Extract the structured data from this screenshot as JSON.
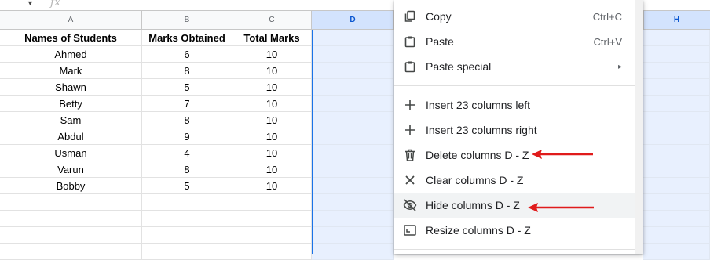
{
  "formula_bar": {
    "fx_symbol": "fx"
  },
  "column_headers": {
    "A": "A",
    "B": "B",
    "C": "C",
    "D": "D",
    "H": "H"
  },
  "table": {
    "headers": [
      "Names of Students",
      "Marks Obtained",
      "Total Marks"
    ],
    "rows": [
      [
        "Ahmed",
        "6",
        "10"
      ],
      [
        "Mark",
        "8",
        "10"
      ],
      [
        "Shawn",
        "5",
        "10"
      ],
      [
        "Betty",
        "7",
        "10"
      ],
      [
        "Sam",
        "8",
        "10"
      ],
      [
        "Abdul",
        "9",
        "10"
      ],
      [
        "Usman",
        "4",
        "10"
      ],
      [
        "Varun",
        "8",
        "10"
      ],
      [
        "Bobby",
        "5",
        "10"
      ]
    ]
  },
  "context_menu": {
    "copy": {
      "label": "Copy",
      "shortcut": "Ctrl+C",
      "icon": "copy-icon"
    },
    "paste": {
      "label": "Paste",
      "shortcut": "Ctrl+V",
      "icon": "clipboard-icon"
    },
    "paste_special": {
      "label": "Paste special",
      "icon": "clipboard-icon",
      "submenu": "▸"
    },
    "insert_left": {
      "label": "Insert 23 columns left",
      "icon": "plus-icon"
    },
    "insert_right": {
      "label": "Insert 23 columns right",
      "icon": "plus-icon"
    },
    "delete": {
      "label": "Delete columns D - Z",
      "icon": "trash-icon"
    },
    "clear": {
      "label": "Clear columns D - Z",
      "icon": "x-icon"
    },
    "hide": {
      "label": "Hide columns D - Z",
      "icon": "eye-off-icon"
    },
    "resize": {
      "label": "Resize columns D - Z",
      "icon": "resize-icon"
    }
  },
  "colors": {
    "selection": "#e8f0fe",
    "selection_header": "#d3e3fd",
    "annotation_arrow": "#e01b1b"
  }
}
